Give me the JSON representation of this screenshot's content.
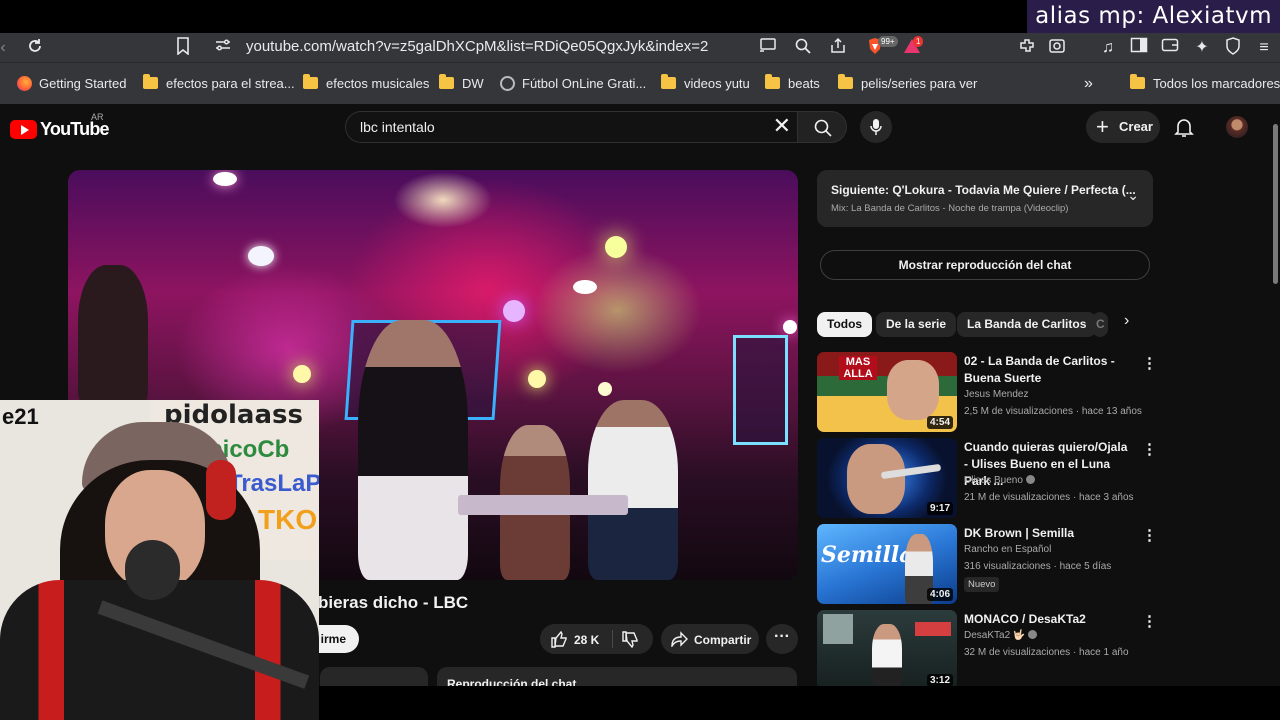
{
  "overlay": {
    "text": "alias mp: Alexiatvm"
  },
  "browser": {
    "url": "youtube.com/watch?v=z5galDhXCpM&list=RDiQe05QgxJyk&index=2",
    "brave_badge": "99+",
    "rewards_badge": "1",
    "bookmarks": [
      {
        "label": "Getting Started",
        "icon": "firefox-icon"
      },
      {
        "label": "efectos para el strea...",
        "icon": "folder-icon"
      },
      {
        "label": "efectos musicales",
        "icon": "folder-icon"
      },
      {
        "label": "DW",
        "icon": "folder-icon"
      },
      {
        "label": "Fútbol OnLine Grati...",
        "icon": "globe-icon"
      },
      {
        "label": "videos yutu",
        "icon": "folder-icon"
      },
      {
        "label": "beats",
        "icon": "folder-icon"
      },
      {
        "label": "pelis/series para ver",
        "icon": "folder-icon"
      }
    ],
    "all_bookmarks": "Todos los marcadores"
  },
  "youtube": {
    "logo_text": "YouTube",
    "country": "AR",
    "search_value": "lbc intentalo",
    "create_label": "Crear",
    "video_title": "bieras dicho - LBC",
    "subscribe_label": "irme",
    "likes": "28 K",
    "share_label": "Compartir",
    "chat_replay_tab": "Reproducción del chat",
    "up_next": {
      "title": "Siguiente: Q'Lokura - Todavia Me Quiere / Perfecta (...",
      "subtitle": "Mix: La Banda de Carlitos - Noche de trampa (Videoclip)"
    },
    "show_chat_button": "Mostrar reproducción del chat",
    "chips": [
      "Todos",
      "De la serie",
      "La Banda de Carlitos",
      "C"
    ],
    "recommendations": [
      {
        "title": "02 - La Banda de Carlitos - Buena Suerte",
        "channel": "Jesus Mendez",
        "meta": "2,5 M de visualizaciones · hace 13 años",
        "duration": "4:54",
        "verified": false,
        "badge": ""
      },
      {
        "title": "Cuando quieras quiero/Ojala - Ulises Bueno en el Luna Park ...",
        "channel": "Ulises Bueno",
        "meta": "21 M de visualizaciones · hace 3 años",
        "duration": "9:17",
        "verified": true,
        "badge": ""
      },
      {
        "title": "DK  Brown | Semilla",
        "channel": "Rancho en Español",
        "meta": "316 visualizaciones · hace 5 días",
        "duration": "4:06",
        "verified": false,
        "badge": "Nuevo",
        "thumb_text": "Semilla"
      },
      {
        "title": "MONACO  / DesaKTa2",
        "channel": "DesaKTa2 🤟🏻",
        "meta": "32 M de visualizaciones · hace 1 año",
        "duration": "3:12",
        "verified": true,
        "badge": ""
      }
    ],
    "first_thumb_text": "MAS ALLA"
  },
  "webcam": {
    "sign_text": "pidolaass",
    "sign_text2": "picoCb",
    "sign_text3": "TrasLaP",
    "sign_text4": "TKO",
    "corner_text": "e21"
  }
}
